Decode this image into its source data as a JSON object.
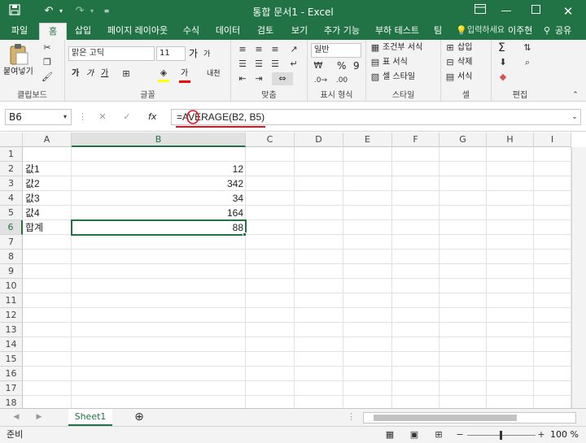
{
  "window": {
    "title": "통합 문서1 - Excel",
    "controls": [
      "save-icon",
      "undo-icon",
      "redo-icon",
      "customize-qat-icon",
      "ribbon-display-icon",
      "minimize-icon",
      "maximize-icon",
      "close-icon"
    ]
  },
  "tabs": [
    "파일",
    "홈",
    "삽입",
    "페이지 레이아웃",
    "수식",
    "데이터",
    "검토",
    "보기",
    "추가 기능",
    "부하 테스트",
    "팀"
  ],
  "active_tab": "홈",
  "tell_me": "입력하세요",
  "user": "이주현",
  "share": "공유",
  "ribbon": {
    "clipboard": {
      "label": "클립보드",
      "paste": "붙여넣기"
    },
    "font": {
      "label": "글꼴",
      "name": "맑은 고딕",
      "size": "11",
      "grow": "가",
      "shrink": "가",
      "bold": "가",
      "italic": "가",
      "underline": "가",
      "font_color_glyph": "가",
      "phonetic": "내천"
    },
    "alignment": {
      "label": "맞춤"
    },
    "number": {
      "label": "표시 형식",
      "format": "일반",
      "percent": "%",
      "comma": "9"
    },
    "styles": {
      "label": "스타일",
      "conditional": "조건부 서식",
      "table": "표 서식",
      "cell": "셀 스타일"
    },
    "cells": {
      "label": "셀",
      "insert": "삽입",
      "delete": "삭제",
      "format": "서식"
    },
    "editing": {
      "label": "편집",
      "sigma": "Σ"
    }
  },
  "formula_bar": {
    "name_box": "B6",
    "fx": "fx",
    "formula": "=AVERAGE(B2, B5)",
    "annotation_color": "#e8101a"
  },
  "grid": {
    "columns": [
      "A",
      "B",
      "C",
      "D",
      "E",
      "F",
      "G",
      "H",
      "I"
    ],
    "rows": [
      "1",
      "2",
      "3",
      "4",
      "5",
      "6",
      "7",
      "8",
      "9",
      "10",
      "11",
      "12",
      "13",
      "14",
      "15",
      "16",
      "17",
      "18"
    ],
    "cells": [
      {
        "row": 2,
        "a": "값1",
        "b": "12"
      },
      {
        "row": 3,
        "a": "값2",
        "b": "342"
      },
      {
        "row": 4,
        "a": "값3",
        "b": "34"
      },
      {
        "row": 5,
        "a": "값4",
        "b": "164"
      },
      {
        "row": 6,
        "a": "합계",
        "b": "88"
      }
    ],
    "selected": "B6"
  },
  "sheets": [
    "Sheet1"
  ],
  "status": {
    "ready": "준비",
    "zoom": "100 %"
  },
  "colors": {
    "accent": "#217346",
    "ribbon_bg": "#f3f3f3",
    "annotation": "#e8101a"
  }
}
